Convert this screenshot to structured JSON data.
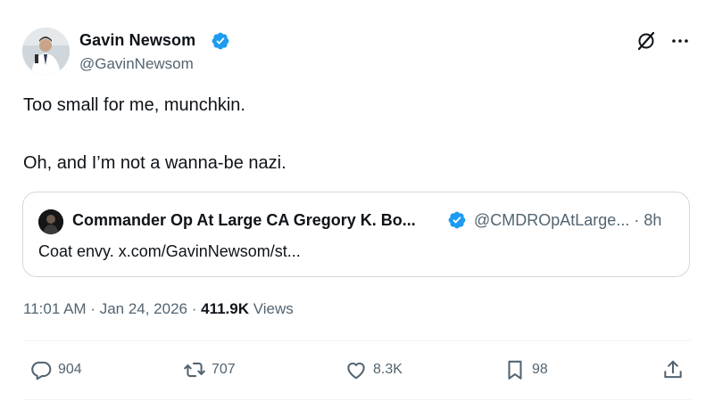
{
  "author": {
    "name": "Gavin Newsom",
    "handle": "@GavinNewsom"
  },
  "tweet": {
    "line1": "Too small for me, munchkin.",
    "line2": "Oh, and I’m not a wanna-be nazi."
  },
  "quote": {
    "name": "Commander Op At Large CA Gregory K. Bo...",
    "handle": "@CMDROpAtLarge... · 8h",
    "text": "Coat envy. x.com/GavinNewsom/st..."
  },
  "meta": {
    "time": "11:01 AM",
    "separator": " · ",
    "date": "Jan 24, 2026",
    "separator2": " · ",
    "views_count": "411.9K",
    "views_label": " Views"
  },
  "actions": {
    "replies": "904",
    "reposts": "707",
    "likes": "8.3K",
    "bookmarks": "98"
  },
  "icons": {
    "verified": "verified-badge-icon",
    "grok": "grok-icon",
    "more": "more-options-icon",
    "reply": "reply-icon",
    "repost": "repost-icon",
    "like": "heart-icon",
    "bookmark": "bookmark-icon",
    "share": "share-icon"
  },
  "colors": {
    "verified_blue": "#1d9bf0",
    "secondary_text": "#536471",
    "primary_text": "#0f1419",
    "border": "#cfd9de"
  }
}
